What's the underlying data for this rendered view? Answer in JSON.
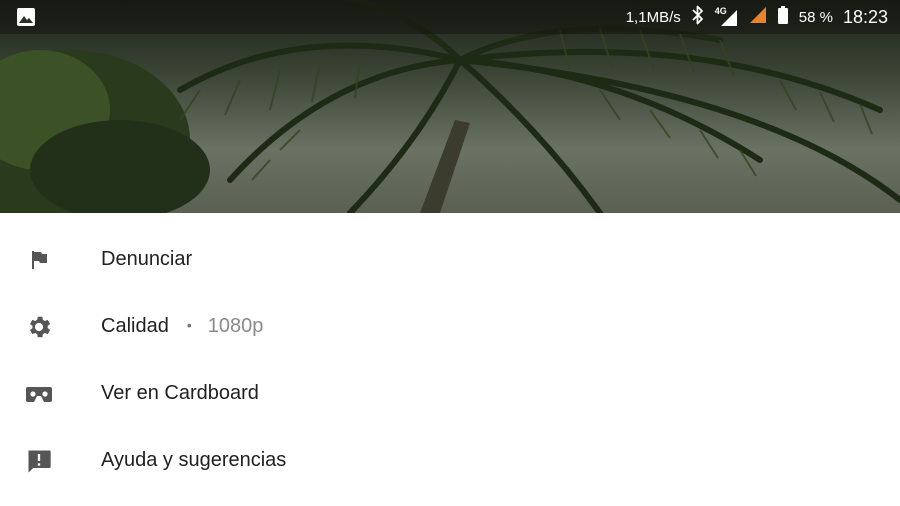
{
  "status_bar": {
    "gallery_icon": "image-icon",
    "net_speed": "1,1MB/s",
    "bluetooth_icon": "bluetooth-icon",
    "network_label": "4G",
    "signal_icon": "signal-icon",
    "battery_pct": "58 %",
    "time": "18:23",
    "accent_color": "#e8842c"
  },
  "menu": {
    "items": [
      {
        "label": "Denunciar",
        "icon": "flag-icon"
      },
      {
        "label": "Calidad",
        "separator": "•",
        "value": "1080p",
        "icon": "gear-icon"
      },
      {
        "label": "Ver en Cardboard",
        "icon": "cardboard-vr-icon"
      },
      {
        "label": "Ayuda y sugerencias",
        "icon": "feedback-icon"
      }
    ]
  }
}
